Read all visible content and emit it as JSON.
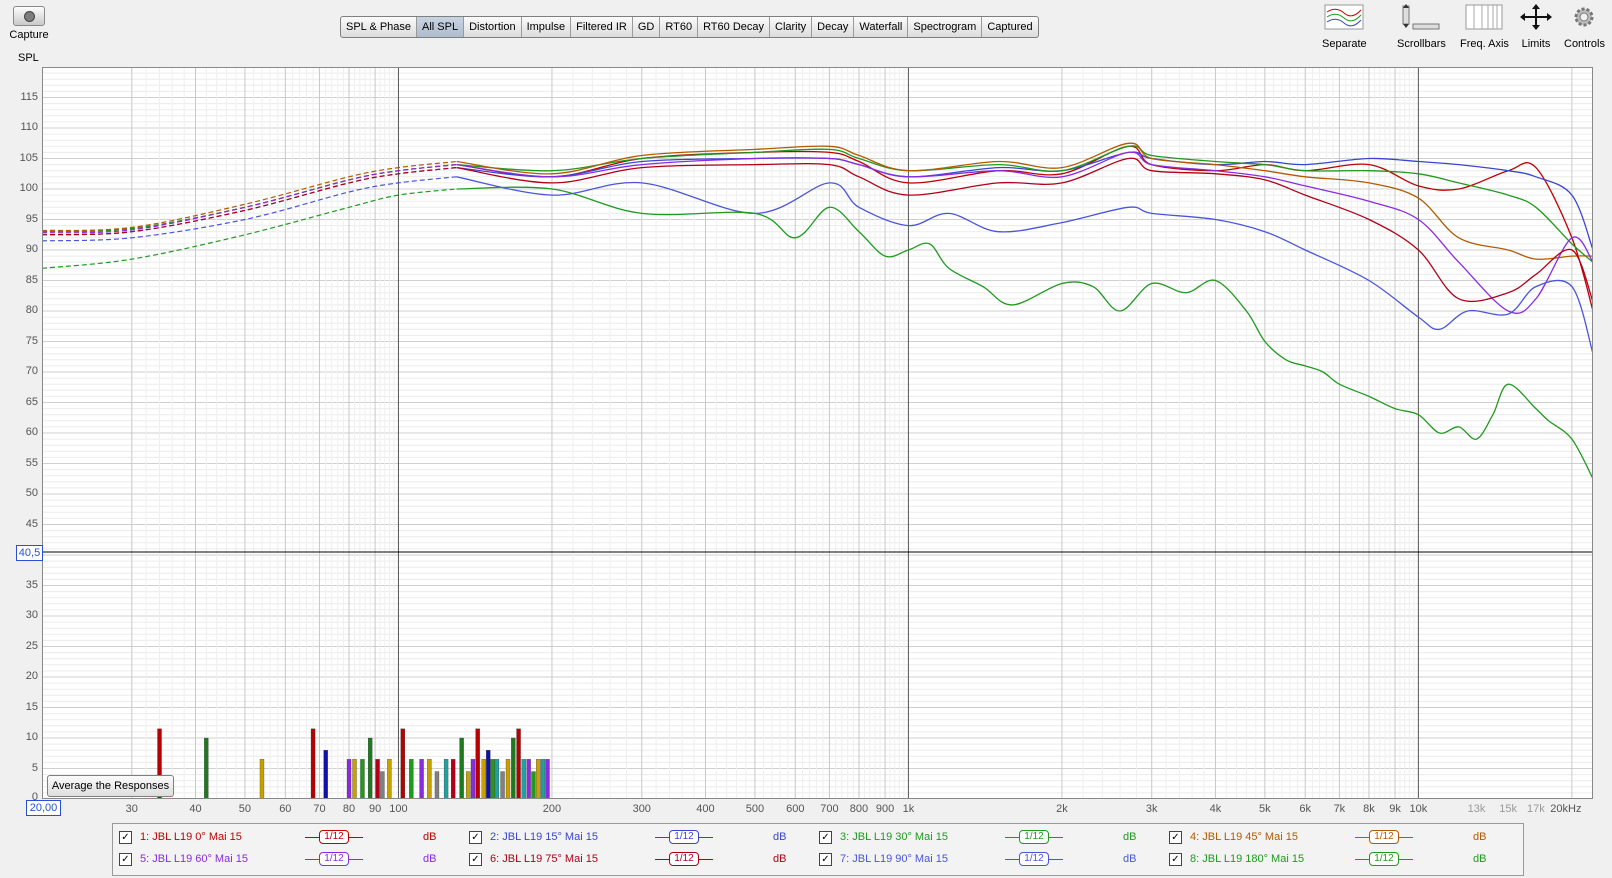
{
  "toolbar": {
    "capture_label": "Capture",
    "spl_axis_label": "SPL",
    "tabs": [
      "SPL & Phase",
      "All SPL",
      "Distortion",
      "Impulse",
      "Filtered IR",
      "GD",
      "RT60",
      "RT60 Decay",
      "Clarity",
      "Decay",
      "Waterfall",
      "Spectrogram",
      "Captured"
    ],
    "active_tab": "All SPL",
    "tools": [
      {
        "label": "Separate",
        "icon": "separate-traces-icon"
      },
      {
        "label": "Scrollbars",
        "icon": "scrollbars-icon"
      },
      {
        "label": "Freq. Axis",
        "icon": "freq-axis-icon"
      },
      {
        "label": "Limits",
        "icon": "limits-icon"
      },
      {
        "label": "Controls",
        "icon": "gear-icon"
      }
    ]
  },
  "cursor_value": "40,5",
  "x_start_value": "20,00",
  "average_button": "Average the Responses",
  "chart_data": {
    "type": "line",
    "x_scale": "log",
    "xlim": [
      20,
      22000
    ],
    "ylim": [
      0,
      120
    ],
    "y_ticks": [
      5,
      10,
      15,
      20,
      25,
      30,
      35,
      45,
      50,
      55,
      60,
      65,
      70,
      75,
      80,
      85,
      90,
      95,
      100,
      105,
      110,
      115
    ],
    "y_tick_labels": [
      "5",
      "10",
      "15",
      "20",
      "25",
      "30",
      "35",
      "45",
      "50",
      "55",
      "60",
      "65",
      "70",
      "75",
      "80",
      "85",
      "90",
      "95",
      "100",
      "105",
      "110",
      "115"
    ],
    "y_zero_label": "0",
    "cursor_line_y": 40.5,
    "x_tick_labels": [
      {
        "f": 30,
        "t": "30",
        "minor": false
      },
      {
        "f": 40,
        "t": "40",
        "minor": false
      },
      {
        "f": 50,
        "t": "50",
        "minor": false
      },
      {
        "f": 60,
        "t": "60",
        "minor": false
      },
      {
        "f": 70,
        "t": "70",
        "minor": false
      },
      {
        "f": 80,
        "t": "80",
        "minor": false
      },
      {
        "f": 90,
        "t": "90",
        "minor": false
      },
      {
        "f": 100,
        "t": "100",
        "minor": false
      },
      {
        "f": 200,
        "t": "200",
        "minor": false
      },
      {
        "f": 300,
        "t": "300",
        "minor": false
      },
      {
        "f": 400,
        "t": "400",
        "minor": false
      },
      {
        "f": 500,
        "t": "500",
        "minor": false
      },
      {
        "f": 600,
        "t": "600",
        "minor": false
      },
      {
        "f": 700,
        "t": "700",
        "minor": false
      },
      {
        "f": 800,
        "t": "800",
        "minor": false
      },
      {
        "f": 900,
        "t": "900",
        "minor": false
      },
      {
        "f": 1000,
        "t": "1k",
        "minor": false
      },
      {
        "f": 2000,
        "t": "2k",
        "minor": false
      },
      {
        "f": 3000,
        "t": "3k",
        "minor": false
      },
      {
        "f": 4000,
        "t": "4k",
        "minor": false
      },
      {
        "f": 5000,
        "t": "5k",
        "minor": false
      },
      {
        "f": 6000,
        "t": "6k",
        "minor": false
      },
      {
        "f": 7000,
        "t": "7k",
        "minor": false
      },
      {
        "f": 8000,
        "t": "8k",
        "minor": false
      },
      {
        "f": 9000,
        "t": "9k",
        "minor": false
      },
      {
        "f": 10000,
        "t": "10k",
        "minor": false
      },
      {
        "f": 13000,
        "t": "13k",
        "minor": true
      },
      {
        "f": 15000,
        "t": "15k",
        "minor": true
      },
      {
        "f": 17000,
        "t": "17k",
        "minor": true
      },
      {
        "f": 20000,
        "t": "20kHz",
        "minor": false
      }
    ],
    "series": [
      {
        "name": "1: JBL L19 0° Mai 15",
        "color": "#c00000",
        "x": [
          20,
          30,
          50,
          80,
          100,
          130,
          200,
          300,
          500,
          700,
          800,
          1000,
          1500,
          2000,
          2700,
          3000,
          4000,
          5000,
          6000,
          8000,
          10000,
          12000,
          15000,
          17000,
          20000,
          22000
        ],
        "y": [
          93,
          93.5,
          97,
          101.5,
          103,
          104,
          102,
          105,
          106,
          106,
          104.5,
          101,
          103,
          102.5,
          107,
          104,
          103,
          104,
          103,
          104,
          100.5,
          100,
          103,
          103.5,
          92,
          80
        ]
      },
      {
        "name": "2: JBL L19 15° Mai 15",
        "color": "#3a45d0",
        "x": [
          20,
          30,
          50,
          80,
          100,
          130,
          200,
          300,
          500,
          700,
          800,
          1000,
          1500,
          2000,
          2700,
          3000,
          4000,
          5000,
          6000,
          8000,
          10000,
          12000,
          15000,
          17000,
          20000,
          22000
        ],
        "y": [
          92.5,
          93,
          96.5,
          101,
          102.5,
          103.5,
          102,
          104.5,
          105,
          105,
          104,
          102,
          103.5,
          103,
          106,
          105,
          104,
          104.5,
          104,
          105,
          104.5,
          104,
          103,
          102,
          99,
          90
        ]
      },
      {
        "name": "3: JBL L19 30° Mai 15",
        "color": "#1f9a1f",
        "x": [
          20,
          30,
          50,
          80,
          100,
          130,
          200,
          300,
          500,
          700,
          800,
          1000,
          1500,
          2000,
          2700,
          3000,
          4000,
          5000,
          6000,
          8000,
          10000,
          12000,
          15000,
          17000,
          20000,
          22000
        ],
        "y": [
          93,
          93.5,
          97,
          101.5,
          103,
          104,
          103,
          105,
          106,
          106.5,
          105,
          103,
          104,
          103,
          107,
          105.5,
          104.5,
          104,
          103,
          103,
          102.5,
          101,
          99,
          97,
          91,
          88
        ]
      },
      {
        "name": "4: JBL L19 45° Mai 15",
        "color": "#b35a00",
        "x": [
          20,
          30,
          50,
          80,
          100,
          130,
          200,
          300,
          500,
          700,
          800,
          1000,
          1500,
          2000,
          2700,
          3000,
          4000,
          5000,
          6000,
          8000,
          10000,
          12000,
          15000,
          17000,
          20000,
          22000
        ],
        "y": [
          93.2,
          93.7,
          97.5,
          102,
          103.5,
          104.5,
          102.5,
          105.5,
          106.5,
          107,
          105.5,
          103,
          104.5,
          103.5,
          107.5,
          105,
          104,
          103,
          102,
          101,
          98.5,
          92,
          90,
          88.5,
          89,
          89
        ]
      },
      {
        "name": "5: JBL L19 60° Mai 15",
        "color": "#8a2be2",
        "x": [
          20,
          30,
          50,
          80,
          100,
          130,
          200,
          300,
          500,
          700,
          800,
          1000,
          1500,
          2000,
          2700,
          3000,
          4000,
          5000,
          6000,
          8000,
          10000,
          12000,
          15000,
          17000,
          20000,
          22000
        ],
        "y": [
          92.8,
          93.3,
          97,
          101.5,
          103,
          104,
          102,
          104,
          105,
          105,
          104,
          102,
          103,
          102,
          106,
          104,
          103,
          102,
          100.5,
          98,
          95,
          88,
          80,
          82,
          92,
          88
        ]
      },
      {
        "name": "6: JBL L19 75° Mai 15",
        "color": "#b00018",
        "x": [
          20,
          30,
          50,
          80,
          100,
          130,
          200,
          300,
          500,
          700,
          800,
          1000,
          1500,
          2000,
          2700,
          3000,
          4000,
          5000,
          6000,
          8000,
          10000,
          12000,
          15000,
          17000,
          20000,
          22000
        ],
        "y": [
          92.5,
          93,
          96.5,
          101,
          102.5,
          103.5,
          101,
          103.5,
          104,
          104,
          102,
          99,
          101,
          101,
          105,
          103,
          102.5,
          101.5,
          99,
          95,
          90,
          82,
          83,
          86,
          90,
          81.5
        ]
      },
      {
        "name": "7: JBL L19 90° Mai 15",
        "color": "#4a55dc",
        "x": [
          20,
          30,
          50,
          80,
          100,
          130,
          200,
          300,
          500,
          700,
          800,
          1000,
          1200,
          1500,
          2000,
          2700,
          3000,
          4000,
          5000,
          6000,
          8000,
          10000,
          11000,
          12500,
          15000,
          17000,
          20000,
          22000
        ],
        "y": [
          91.5,
          92,
          95,
          99.5,
          101,
          102,
          99,
          101,
          96,
          101,
          97,
          94,
          96,
          93,
          94.5,
          97,
          96,
          95,
          93,
          90,
          85,
          79,
          77,
          80,
          79.5,
          84,
          84,
          73
        ]
      },
      {
        "name": "8: JBL L19 180° Mai 15",
        "color": "#1f9a1f",
        "x": [
          20,
          30,
          50,
          80,
          100,
          130,
          200,
          300,
          500,
          600,
          700,
          800,
          900,
          1000,
          1100,
          1200,
          1400,
          1600,
          2000,
          2300,
          2600,
          3000,
          3500,
          4000,
          4600,
          5000,
          5500,
          6000,
          6500,
          7000,
          8000,
          9000,
          10000,
          11000,
          12000,
          13000,
          14000,
          15000,
          17000,
          18000,
          20000,
          22000
        ],
        "y": [
          87,
          88.5,
          92.5,
          97,
          99,
          100,
          100,
          96,
          96,
          92,
          97,
          93,
          89,
          90,
          91,
          87,
          84,
          81,
          84.5,
          84,
          80,
          84.5,
          83,
          85,
          80,
          75,
          72,
          71,
          70,
          68,
          66,
          64,
          63,
          60,
          61,
          59,
          63,
          68,
          64,
          62,
          59,
          52.5
        ]
      }
    ],
    "bars": [
      {
        "f": 34,
        "v": 11.5,
        "c": "#b80000"
      },
      {
        "f": 42,
        "v": 10,
        "c": "#1f7a1f"
      },
      {
        "f": 54,
        "v": 6.5,
        "c": "#c8a000"
      },
      {
        "f": 68,
        "v": 11.5,
        "c": "#b80000"
      },
      {
        "f": 72,
        "v": 8,
        "c": "#1010aa"
      },
      {
        "f": 80,
        "v": 6.5,
        "c": "#8a2be2"
      },
      {
        "f": 82,
        "v": 6.5,
        "c": "#c8a000"
      },
      {
        "f": 85,
        "v": 6.5,
        "c": "#1f9a1f"
      },
      {
        "f": 88,
        "v": 10,
        "c": "#1f7a1f"
      },
      {
        "f": 91,
        "v": 6.5,
        "c": "#b00018"
      },
      {
        "f": 93,
        "v": 4.5,
        "c": "#808080"
      },
      {
        "f": 96,
        "v": 6.5,
        "c": "#c8a000"
      },
      {
        "f": 102,
        "v": 11.5,
        "c": "#b80000"
      },
      {
        "f": 106,
        "v": 6.5,
        "c": "#1f9a1f"
      },
      {
        "f": 111,
        "v": 6.5,
        "c": "#8a2be2"
      },
      {
        "f": 115,
        "v": 6.5,
        "c": "#c8a000"
      },
      {
        "f": 119,
        "v": 4.5,
        "c": "#808080"
      },
      {
        "f": 124,
        "v": 6.5,
        "c": "#20a0a0"
      },
      {
        "f": 128,
        "v": 6.5,
        "c": "#b00018"
      },
      {
        "f": 133,
        "v": 10,
        "c": "#1f7a1f"
      },
      {
        "f": 137,
        "v": 4.5,
        "c": "#c8a000"
      },
      {
        "f": 140,
        "v": 6.5,
        "c": "#8a2be2"
      },
      {
        "f": 143,
        "v": 11.5,
        "c": "#b80000"
      },
      {
        "f": 147,
        "v": 6.5,
        "c": "#c8a000"
      },
      {
        "f": 150,
        "v": 8,
        "c": "#1010aa"
      },
      {
        "f": 153,
        "v": 6.5,
        "c": "#1f9a1f"
      },
      {
        "f": 156,
        "v": 6.5,
        "c": "#20a0a0"
      },
      {
        "f": 160,
        "v": 4.5,
        "c": "#808080"
      },
      {
        "f": 164,
        "v": 6.5,
        "c": "#c8a000"
      },
      {
        "f": 168,
        "v": 10,
        "c": "#1f7a1f"
      },
      {
        "f": 172,
        "v": 11.5,
        "c": "#b80000"
      },
      {
        "f": 176,
        "v": 6.5,
        "c": "#20a0a0"
      },
      {
        "f": 180,
        "v": 6.5,
        "c": "#8a2be2"
      },
      {
        "f": 184,
        "v": 4.5,
        "c": "#1f9a1f"
      },
      {
        "f": 188,
        "v": 6.5,
        "c": "#c8a000"
      },
      {
        "f": 192,
        "v": 6.5,
        "c": "#20a0a0"
      },
      {
        "f": 196,
        "v": 6.5,
        "c": "#8a2be2"
      }
    ]
  },
  "legend": {
    "smoothing": "1/12",
    "unit": "dB",
    "items": [
      {
        "name": "1: JBL L19 0° Mai 15",
        "color": "#c00000",
        "checked": "✓"
      },
      {
        "name": "2: JBL L19 15° Mai 15",
        "color": "#3a45d0",
        "checked": "✓"
      },
      {
        "name": "3: JBL L19 30° Mai 15",
        "color": "#1f9a1f",
        "checked": "✓"
      },
      {
        "name": "4: JBL L19 45° Mai 15",
        "color": "#b35a00",
        "checked": "✓"
      },
      {
        "name": "5: JBL L19 60° Mai 15",
        "color": "#8a2be2",
        "checked": "✓"
      },
      {
        "name": "6: JBL L19 75° Mai 15",
        "color": "#b00018",
        "checked": "✓"
      },
      {
        "name": "7: JBL L19 90° Mai 15",
        "color": "#4a55dc",
        "checked": "✓"
      },
      {
        "name": "8: JBL L19 180° Mai 15",
        "color": "#1f9a1f",
        "checked": "✓"
      }
    ]
  }
}
